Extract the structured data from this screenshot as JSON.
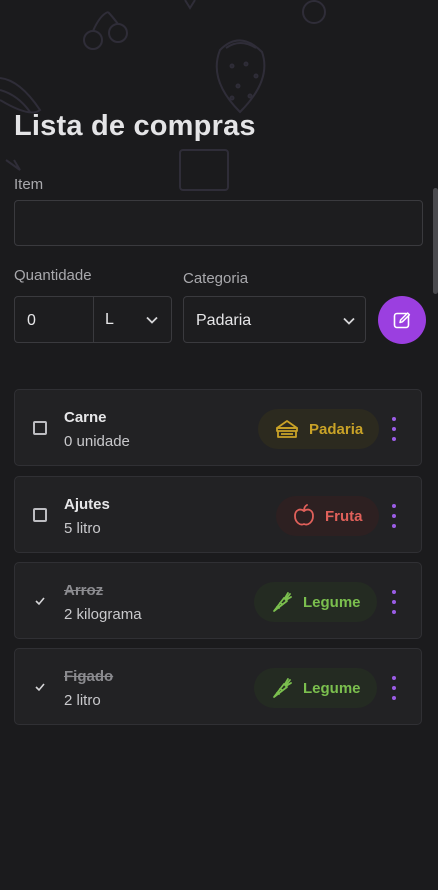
{
  "page": {
    "title": "Lista de compras"
  },
  "form": {
    "item_label": "Item",
    "item_value": "",
    "quantity_label": "Quantidade",
    "quantity_value": "0",
    "unit_value": "L",
    "category_label": "Categoria",
    "category_value": "Padaria"
  },
  "items": [
    {
      "name": "Carne",
      "qty": "0 unidade",
      "checked": false,
      "category": "Padaria",
      "icon": "bread-icon",
      "color": "#c9a227",
      "bg": "#2c2a1f"
    },
    {
      "name": "Ajutes",
      "qty": "5 litro",
      "checked": false,
      "category": "Fruta",
      "icon": "apple-icon",
      "color": "#e0605a",
      "bg": "#2d2021"
    },
    {
      "name": "Arroz",
      "qty": "2 kilograma",
      "checked": true,
      "category": "Legume",
      "icon": "carrot-icon",
      "color": "#7bbf4e",
      "bg": "#242b22"
    },
    {
      "name": "Figado",
      "qty": "2 litro",
      "checked": true,
      "category": "Legume",
      "icon": "carrot-icon",
      "color": "#7bbf4e",
      "bg": "#242b22"
    }
  ],
  "colors": {
    "accent": "#9b3fe0",
    "background": "#1b1b1d"
  }
}
